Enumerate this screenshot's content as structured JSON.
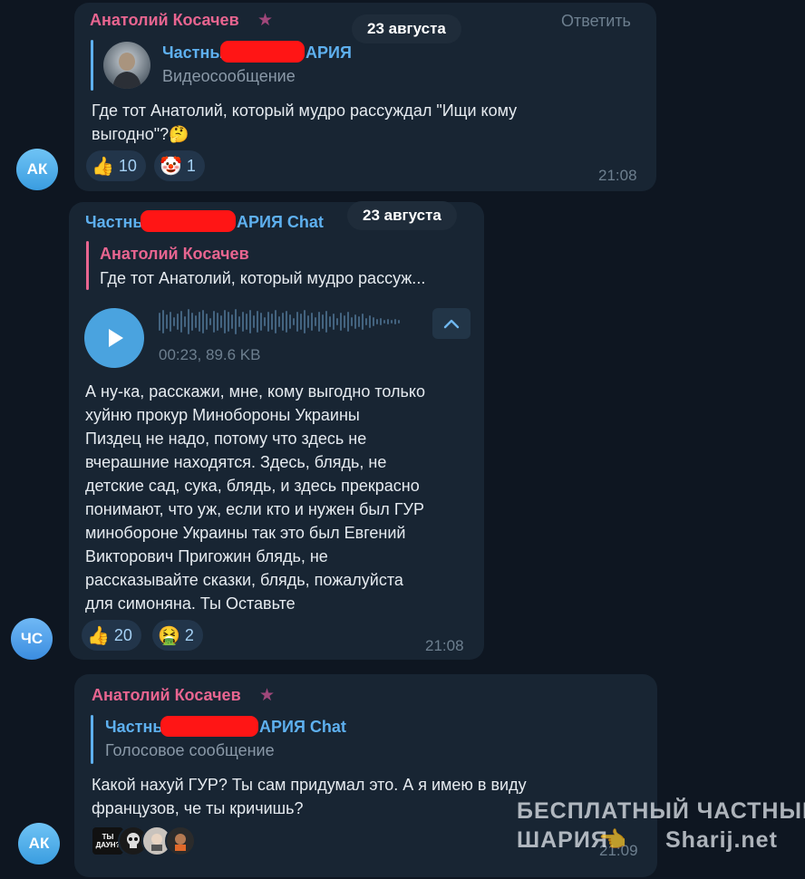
{
  "date_label": "23 августа",
  "reply_action": "Ответить",
  "messages": [
    {
      "avatar": "АК",
      "sender": "Анатолий Косачев",
      "quote_name_left": "Частны",
      "quote_name_right": "АРИЯ",
      "quote_type": "Видеосообщение",
      "text": "Где тот Анатолий, который мудро рассуждал \"Ищи кому\nвыгодно\"?🤔",
      "reactions": [
        {
          "emoji": "👍",
          "count": "10"
        },
        {
          "emoji": "🤡",
          "count": "1"
        }
      ],
      "time": "21:08"
    },
    {
      "avatar": "ЧС",
      "sender_left": "Частны",
      "sender_right": "АРИЯ Chat",
      "quote_name": "Анатолий Косачев",
      "quote_text": "Где тот Анатолий, который мудро рассуж...",
      "audio_meta": "00:23, 89.6 KB",
      "text": "А ну-ка, расскажи, мне, кому выгодно только\nхуйню прокур Минобороны Украины\nПиздец не надо, потому что здесь не\nвчерашние находятся. Здесь, блядь, не\nдетские сад, сука, блядь, и здесь прекрасно\nпонимают, что уж, если кто и нужен был ГУР\nминобороне Украины так это был Евгений\nВикторович Пригожин блядь, не\nрассказывайте сказки, блядь, пожалуйста\nдля симоняна. Ты Оставьте",
      "reactions": [
        {
          "emoji": "👍",
          "count": "20"
        },
        {
          "emoji": "🤮",
          "count": "2"
        }
      ],
      "time": "21:08"
    },
    {
      "avatar": "АК",
      "sender": "Анатолий Косачев",
      "quote_name_left": "Частны",
      "quote_name_right": "АРИЯ Chat",
      "quote_type": "Голосовое сообщение",
      "text": "Какой нахуй ГУР? Ты сам придумал это. А я имею в виду\nфранцузов, че ты кричишь?",
      "sticker_label": "ТЫ ДАУН?",
      "time": "21:09"
    }
  ],
  "watermark": {
    "line1": "БЕСПЛАТНЫЙ  ЧАСТНЫЙ",
    "line2_left": "ШАРИЯ",
    "line2_right": "Sharij.net"
  },
  "colors": {
    "background": "#0e1621",
    "bubble": "#182533",
    "sender_pink": "#e86590",
    "sender_blue": "#5eb0ef",
    "redaction": "#ff1515"
  }
}
